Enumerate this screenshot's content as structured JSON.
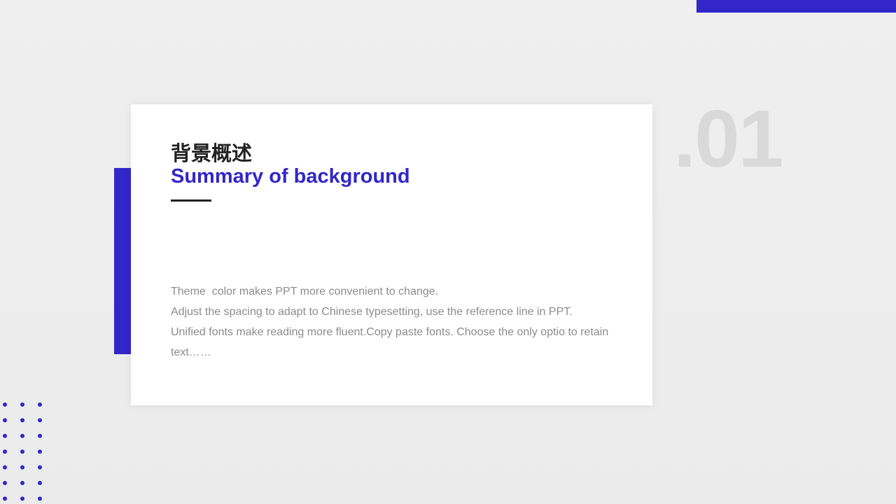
{
  "slide": {
    "number": ".01",
    "title_cn": "背景概述",
    "title_en": "Summary of background",
    "body_lines": [
      "Theme  color makes PPT more convenient to change.",
      "Adjust the spacing to adapt to Chinese typesetting, use the reference line in PPT.",
      "Unified fonts make reading more fluent.Copy paste fonts. Choose the only optio to retain",
      "text……"
    ]
  },
  "colors": {
    "accent": "#3326c9",
    "title_cn": "#222222",
    "body_text": "#8c8c8c",
    "number": "#d9d9d9",
    "divider": "#222222",
    "background": "#ececec",
    "card": "#ffffff"
  },
  "decorations": {
    "dot_grid": {
      "rows": 7,
      "cols": 3
    }
  }
}
